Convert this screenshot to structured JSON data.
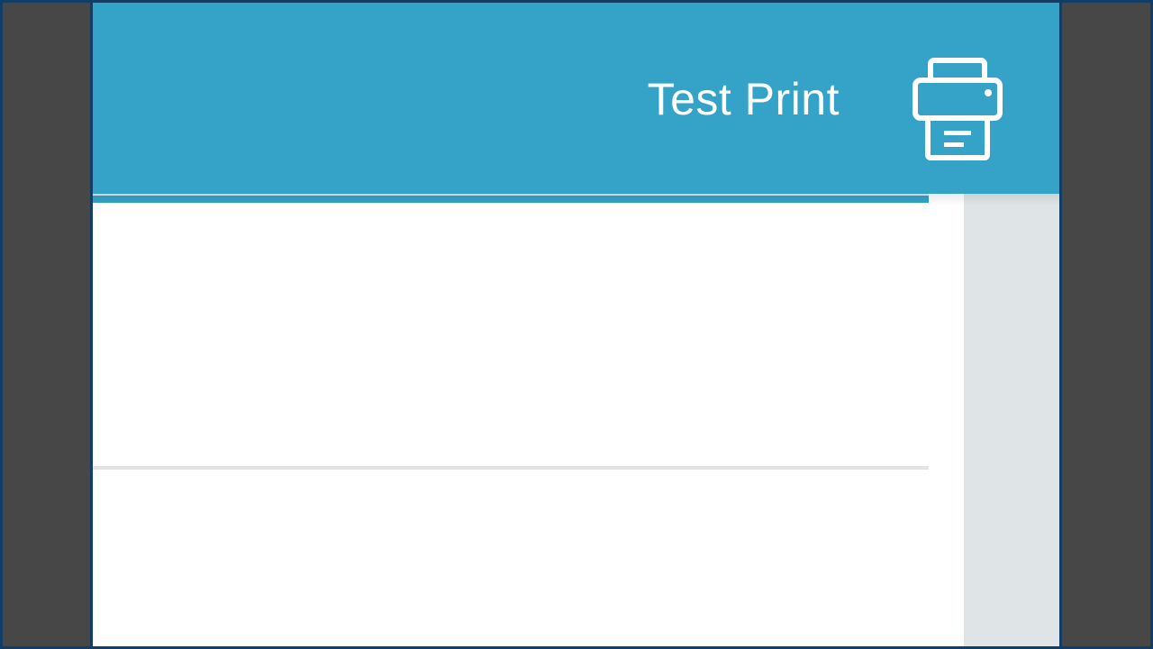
{
  "header": {
    "title": "Test Print",
    "background_color": "#35a2c8",
    "print_icon": "printer-icon"
  },
  "colors": {
    "frame_border": "#123e66",
    "outer_background": "#474747",
    "side_panel": "#dfe4e7",
    "divider": "#e3e3e3"
  }
}
